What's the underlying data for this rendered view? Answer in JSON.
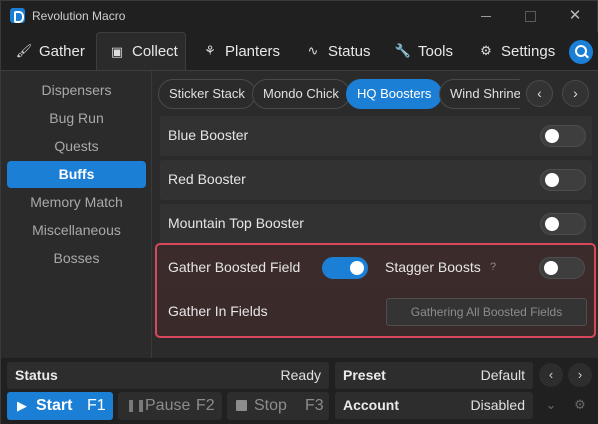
{
  "window": {
    "title": "Revolution Macro"
  },
  "tabs": [
    {
      "label": "Gather",
      "icon": "brush-icon",
      "active": false
    },
    {
      "label": "Collect",
      "icon": "collect-icon",
      "active": true
    },
    {
      "label": "Planters",
      "icon": "sprout-icon",
      "active": false
    },
    {
      "label": "Status",
      "icon": "pulse-icon",
      "active": false
    },
    {
      "label": "Tools",
      "icon": "wrench-icon",
      "active": false
    },
    {
      "label": "Settings",
      "icon": "gear-icon",
      "active": false
    }
  ],
  "sidebar": {
    "items": [
      {
        "label": "Dispensers",
        "active": false
      },
      {
        "label": "Bug Run",
        "active": false
      },
      {
        "label": "Quests",
        "active": false
      },
      {
        "label": "Buffs",
        "active": true
      },
      {
        "label": "Memory Match",
        "active": false
      },
      {
        "label": "Miscellaneous",
        "active": false
      },
      {
        "label": "Bosses",
        "active": false
      }
    ]
  },
  "subtabs": [
    {
      "label": "Sticker Stack",
      "active": false
    },
    {
      "label": "Mondo Chick",
      "active": false
    },
    {
      "label": "HQ Boosters",
      "active": true
    },
    {
      "label": "Wind Shrine",
      "active": false
    }
  ],
  "settings": {
    "blue_booster": {
      "label": "Blue Booster",
      "enabled": false
    },
    "red_booster": {
      "label": "Red Booster",
      "enabled": false
    },
    "mountain_top_booster": {
      "label": "Mountain Top Booster",
      "enabled": false
    },
    "gather_boosted_field": {
      "label": "Gather Boosted Field",
      "enabled": true
    },
    "stagger_boosts": {
      "label": "Stagger Boosts",
      "hint": "?",
      "enabled": false
    },
    "gather_in_fields": {
      "label": "Gather In Fields",
      "button": "Gathering All Boosted Fields"
    }
  },
  "status": {
    "label": "Status",
    "value": "Ready"
  },
  "preset": {
    "label": "Preset",
    "value": "Default"
  },
  "account": {
    "label": "Account",
    "value": "Disabled"
  },
  "controls": {
    "start": {
      "label": "Start",
      "key": "F1"
    },
    "pause": {
      "label": "Pause",
      "key": "F2"
    },
    "stop": {
      "label": "Stop",
      "key": "F3"
    }
  },
  "colors": {
    "accent": "#1c7fd6",
    "highlight_border": "#d8485a"
  }
}
